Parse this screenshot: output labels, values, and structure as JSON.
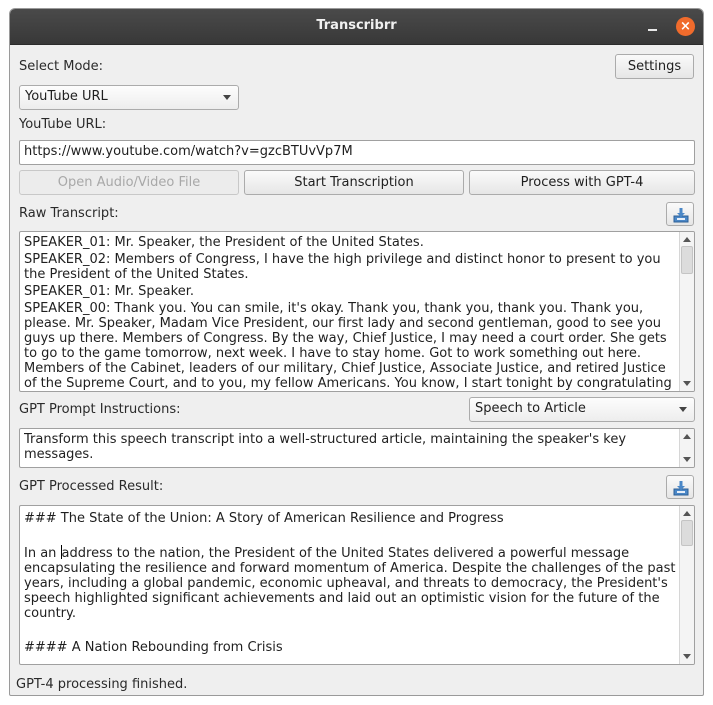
{
  "window": {
    "title": "Transcribrr",
    "minimize_symbol": "",
    "close_symbol": "×"
  },
  "mode": {
    "label": "Select Mode:",
    "selected": "YouTube URL"
  },
  "settings_label": "Settings",
  "url": {
    "label": "YouTube URL:",
    "value": "https://www.youtube.com/watch?v=gzcBTUvVp7M"
  },
  "actions": {
    "open_file": "Open Audio/Video File",
    "start": "Start Transcription",
    "process": "Process with GPT-4"
  },
  "raw_transcript": {
    "label": "Raw Transcript:",
    "save_icon": "save-icon",
    "lines": [
      "SPEAKER_01: Mr. Speaker, the President of the United States.",
      "SPEAKER_02: Members of Congress, I have the high privilege and distinct honor to present to you the President of the United States.",
      "SPEAKER_01: Mr. Speaker.",
      "SPEAKER_00: Thank you. You can smile, it's okay. Thank you, thank you, thank you. Thank you, please. Mr. Speaker, Madam Vice President, our first lady and second gentleman, good to see you guys up there. Members of Congress. By the way, Chief Justice, I may need a court order. She gets to go to the game tomorrow, next week. I have to stay home. Got to work something out here. Members of the Cabinet, leaders of our military, Chief Justice, Associate Justice, and retired Justice of the Supreme Court, and to you, my fellow Americans. You know, I start tonight by congratulating"
    ]
  },
  "prompt": {
    "label": "GPT Prompt Instructions:",
    "preset": "Speech to Article",
    "text": "Transform this speech transcript into a well-structured article, maintaining the speaker's key messages."
  },
  "result": {
    "label": "GPT Processed Result:",
    "save_icon": "save-icon",
    "heading": "### The State of the Union: A Story of American Resilience and Progress",
    "para_start": "In an ",
    "para_rest": "address to the nation, the President of the United States delivered a powerful message encapsulating the resilience and forward momentum of America. Despite the challenges of the past years, including a global pandemic, economic upheaval, and threats to democracy, the President's speech highlighted significant achievements and laid out an optimistic vision for the future of the country.",
    "subheading": "#### A Nation Rebounding from Crisis"
  },
  "status": "GPT-4 processing finished."
}
